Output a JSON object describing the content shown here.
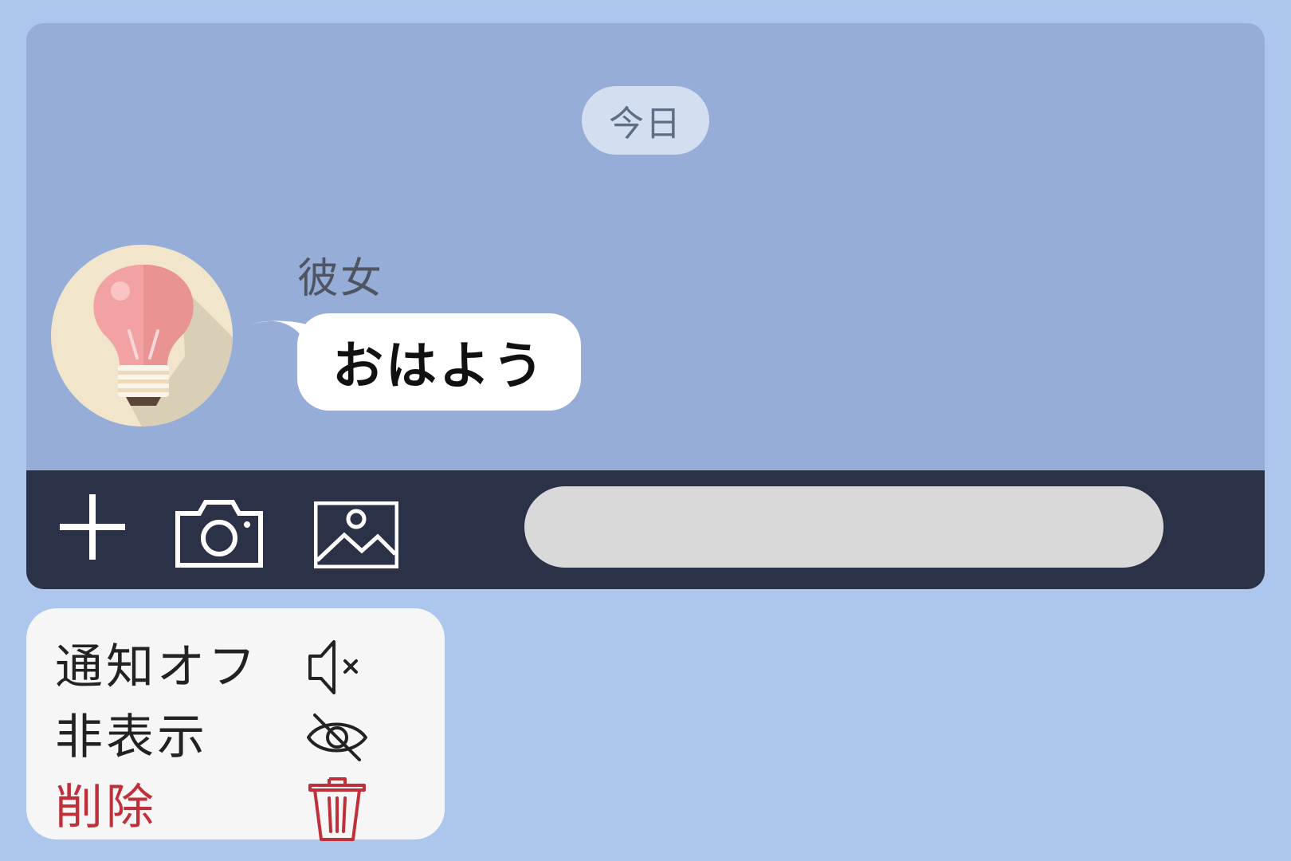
{
  "chat": {
    "date_label": "今日",
    "sender_name": "彼女",
    "message_text": "おはよう"
  },
  "toolbar": {
    "input_placeholder": "",
    "icons": [
      "plus-icon",
      "camera-icon",
      "image-icon"
    ]
  },
  "context_menu": {
    "items": [
      {
        "label": "通知オフ",
        "icon": "mute-icon"
      },
      {
        "label": "非表示",
        "icon": "eye-off-icon"
      },
      {
        "label": "削除",
        "icon": "trash-icon",
        "danger": true
      }
    ]
  },
  "colors": {
    "page_background": "#adc6ee",
    "chat_background": "#95add7",
    "toolbar_background": "#2b3248",
    "input_background": "#d9d9d9",
    "menu_background": "#f6f6f6",
    "danger": "#c0303a"
  }
}
